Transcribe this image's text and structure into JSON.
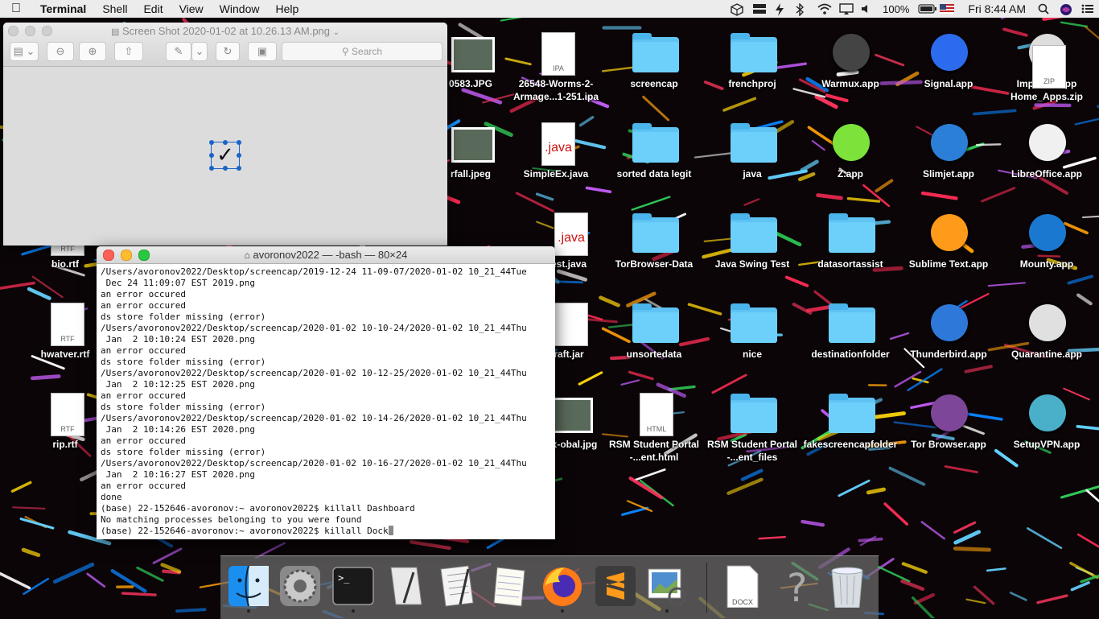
{
  "menubar": {
    "app_name": "Terminal",
    "menus": [
      "Shell",
      "Edit",
      "View",
      "Window",
      "Help"
    ],
    "battery": "100%",
    "clock": "Fri 8:44 AM"
  },
  "desktop": {
    "icons": [
      {
        "label": "0583.JPG",
        "type": "image"
      },
      {
        "label": "26548-Worms-2-Armage...1-251.ipa",
        "type": "ipa"
      },
      {
        "label": "screencap",
        "type": "folder"
      },
      {
        "label": "frenchproj",
        "type": "folder"
      },
      {
        "label": "Warmux.app",
        "type": "app"
      },
      {
        "label": "Signal.app",
        "type": "app"
      },
      {
        "label": "Impactor.app",
        "type": "app"
      },
      {
        "label": "Home_Apps.zip",
        "type": "zip"
      },
      {
        "label": "rfall.jpeg",
        "type": "image"
      },
      {
        "label": "SimpleEx.java",
        "type": "java"
      },
      {
        "label": "sorted data legit",
        "type": "folder"
      },
      {
        "label": "java",
        "type": "folder"
      },
      {
        "label": "Z.app",
        "type": "app"
      },
      {
        "label": "Slimjet.app",
        "type": "app"
      },
      {
        "label": "LibreOffice.app",
        "type": "app"
      },
      {
        "label": "bio.rtf",
        "type": "rtf"
      },
      {
        "label": "est.java",
        "type": "java"
      },
      {
        "label": "TorBrowser-Data",
        "type": "folder"
      },
      {
        "label": "Java Swing Test",
        "type": "folder"
      },
      {
        "label": "datasortassist",
        "type": "folder"
      },
      {
        "label": "Sublime Text.app",
        "type": "app"
      },
      {
        "label": "Mounty.app",
        "type": "app"
      },
      {
        "label": "hwatver.rtf",
        "type": "rtf"
      },
      {
        "label": "raft.jar",
        "type": "jar"
      },
      {
        "label": "unsortedata",
        "type": "folder"
      },
      {
        "label": "nice",
        "type": "folder"
      },
      {
        "label": "destinationfolder",
        "type": "folder"
      },
      {
        "label": "Thunderbird.app",
        "type": "app"
      },
      {
        "label": "Quarantine.app",
        "type": "app"
      },
      {
        "label": "rip.rtf",
        "type": "rtf"
      },
      {
        "label": "4px-obal.jpg",
        "type": "image"
      },
      {
        "label": "RSM Student Portal -...ent.html",
        "type": "html"
      },
      {
        "label": "RSM Student Portal -...ent_files",
        "type": "folder"
      },
      {
        "label": "fakescreencapfolder",
        "type": "folder"
      },
      {
        "label": "Tor Browser.app",
        "type": "app"
      },
      {
        "label": "SetupVPN.app",
        "type": "app"
      }
    ],
    "file_tags": {
      "ipa": "IPA",
      "zip": "ZIP",
      "java": ".java",
      "rtf": "RTF",
      "html": "HTML",
      "docx": "DOCX"
    }
  },
  "preview": {
    "title": "Screen Shot 2020-01-02 at 10.26.13 AM.png",
    "search_placeholder": "Search",
    "content_glyph": "✓"
  },
  "terminal": {
    "title": "avoronov2022 — -bash — 80×24",
    "lines": [
      "/Users/avoronov2022/Desktop/screencap/2019-12-24 11-09-07/2020-01-02 10_21_44Tue",
      " Dec 24 11:09:07 EST 2019.png",
      "an error occured",
      "an error occured",
      "ds store folder missing (error)",
      "/Users/avoronov2022/Desktop/screencap/2020-01-02 10-10-24/2020-01-02 10_21_44Thu",
      " Jan  2 10:10:24 EST 2020.png",
      "an error occured",
      "ds store folder missing (error)",
      "/Users/avoronov2022/Desktop/screencap/2020-01-02 10-12-25/2020-01-02 10_21_44Thu",
      " Jan  2 10:12:25 EST 2020.png",
      "an error occured",
      "ds store folder missing (error)",
      "/Users/avoronov2022/Desktop/screencap/2020-01-02 10-14-26/2020-01-02 10_21_44Thu",
      " Jan  2 10:14:26 EST 2020.png",
      "an error occured",
      "ds store folder missing (error)",
      "/Users/avoronov2022/Desktop/screencap/2020-01-02 10-16-27/2020-01-02 10_21_44Thu",
      " Jan  2 10:16:27 EST 2020.png",
      "an error occured",
      "done",
      "(base) 22-152646-avoronov:~ avoronov2022$ killall Dashboard",
      "No matching processes belonging to you were found",
      "(base) 22-152646-avoronov:~ avoronov2022$ killall Dock"
    ]
  },
  "dock": {
    "apps": [
      "finder-icon",
      "system-preferences-icon",
      "terminal-icon",
      "script-editor-icon",
      "textedit-icon",
      "notes-icon",
      "firefox-icon",
      "sublime-text-icon",
      "preview-icon"
    ],
    "documents": [
      "docx-document-icon",
      "unknown-item-icon",
      "trash-icon"
    ],
    "terminal_prompt": ">_"
  },
  "colors": {
    "folder": "#6dd0fb",
    "terminal_close": "#fc5f57",
    "terminal_min": "#fdbc2e",
    "terminal_max": "#28c840",
    "selection_blue": "#1a64c8"
  }
}
